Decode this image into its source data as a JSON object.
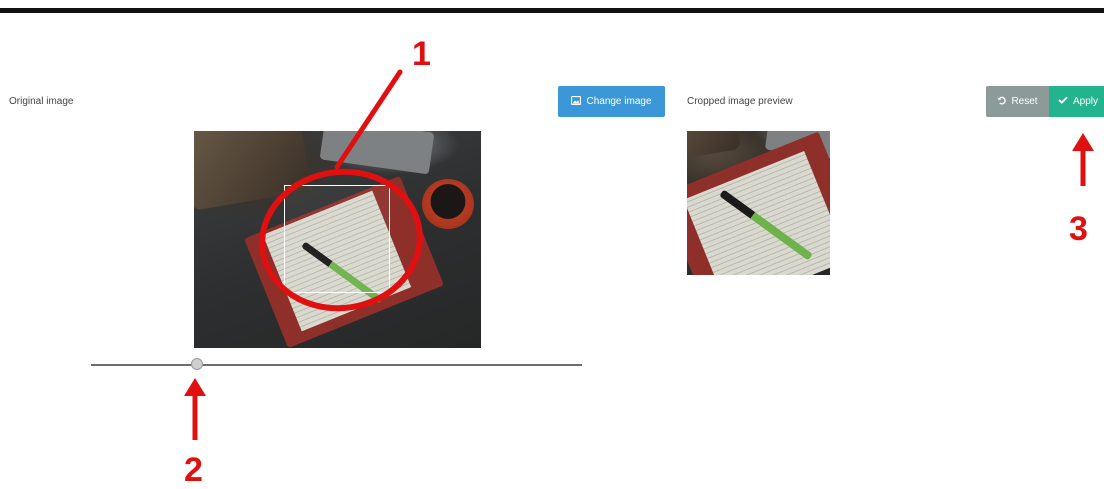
{
  "original": {
    "label": "Original image",
    "change_button": {
      "label": "Change image",
      "icon": "image-icon"
    }
  },
  "preview": {
    "label": "Cropped image preview",
    "reset_button": {
      "label": "Reset",
      "icon": "undo-icon"
    },
    "apply_button": {
      "label": "Apply",
      "icon": "check-icon"
    }
  },
  "zoom_slider": {
    "value": 0.21
  },
  "annotations": [
    "1",
    "2",
    "3"
  ],
  "colors": {
    "primary": "#3b97d8",
    "reset": "#8c9a9a",
    "apply": "#23b38d",
    "annotation": "#e01010"
  }
}
